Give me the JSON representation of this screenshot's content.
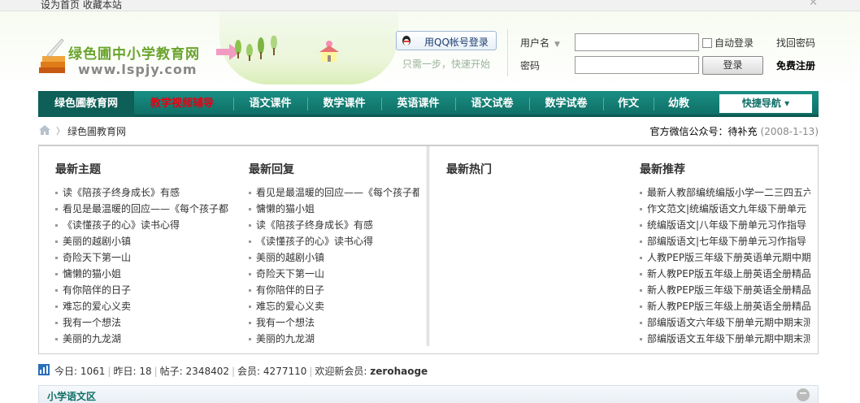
{
  "topbar": {
    "set_home": "设为首页",
    "bookmark": "收藏本站",
    "close_glyph": "✕"
  },
  "header": {
    "logo_title": "绿色圃中小学教育网",
    "logo_url": "www.lspjy.com",
    "qq_login": "用QQ帐号登录",
    "qq_sub": "只需一步，快速开始",
    "username_label": "用户名",
    "password_label": "密码",
    "username_value": "",
    "password_value": "",
    "auto_login": "自动登录",
    "find_password": "找回密码",
    "login_button": "登录",
    "register": "免费注册"
  },
  "nav": {
    "items": [
      "绿色圃教育网",
      "教学视频辅导",
      "语文课件",
      "数学课件",
      "英语课件",
      "语文试卷",
      "数学试卷",
      "作文",
      "幼教"
    ],
    "quick_nav": "快捷导航"
  },
  "breadcrumb": {
    "current": "绿色圃教育网",
    "wechat": "官方微信公众号：待补充",
    "date": "(2008-1-13)"
  },
  "boxes": {
    "latest_topics": {
      "title": "最新主题",
      "items": [
        "读《陪孩子终身成长》有感",
        "看见是最温暖的回应——《每个孩子都",
        "《读懂孩子的心》读书心得",
        "美丽的越剧小镇",
        "奇险天下第一山",
        "慵懒的猫小姐",
        "有你陪伴的日子",
        "难忘的爱心义卖",
        "我有一个想法",
        "美丽的九龙湖"
      ]
    },
    "latest_replies": {
      "title": "最新回复",
      "items": [
        "看见是最温暖的回应——《每个孩子都",
        "慵懒的猫小姐",
        "读《陪孩子终身成长》有感",
        "《读懂孩子的心》读书心得",
        "美丽的越剧小镇",
        "奇险天下第一山",
        "有你陪伴的日子",
        "难忘的爱心义卖",
        "我有一个想法",
        "美丽的九龙湖"
      ]
    },
    "hot": {
      "title": "最新热门",
      "items": []
    },
    "recommend": {
      "title": "最新推荐",
      "items": [
        "最新人教部编统编版小学一二三四五六",
        "作文范文|统编版语文九年级下册单元",
        "统编版语文|八年级下册单元习作指导",
        "部编版语文|七年级下册单元习作指导",
        "人教PEP版三年级下册英语单元期中期",
        "新人教PEP版五年级上册英语全册精品",
        "新人教PEP版三年级下册英语全册精品",
        "新人教PEP版三年级上册英语全册精品",
        "部编版语文六年级下册单元期中期末测",
        "部编版语文五年级下册单元期中期末测"
      ]
    }
  },
  "stats": {
    "today_label": "今日:",
    "today": "1061",
    "yesterday_label": "昨日:",
    "yesterday": "18",
    "posts_label": "帖子:",
    "posts": "2348402",
    "members_label": "会员:",
    "members": "4277110",
    "welcome_label": "欢迎新会员:",
    "newest": "zerohaoge"
  },
  "section": {
    "title": "小学语文区",
    "collapse_glyph": "−"
  },
  "colors": {
    "nav_bg": "#0f6f66",
    "nav_hot": "#e60012",
    "logo_green": "#6aa42c"
  }
}
